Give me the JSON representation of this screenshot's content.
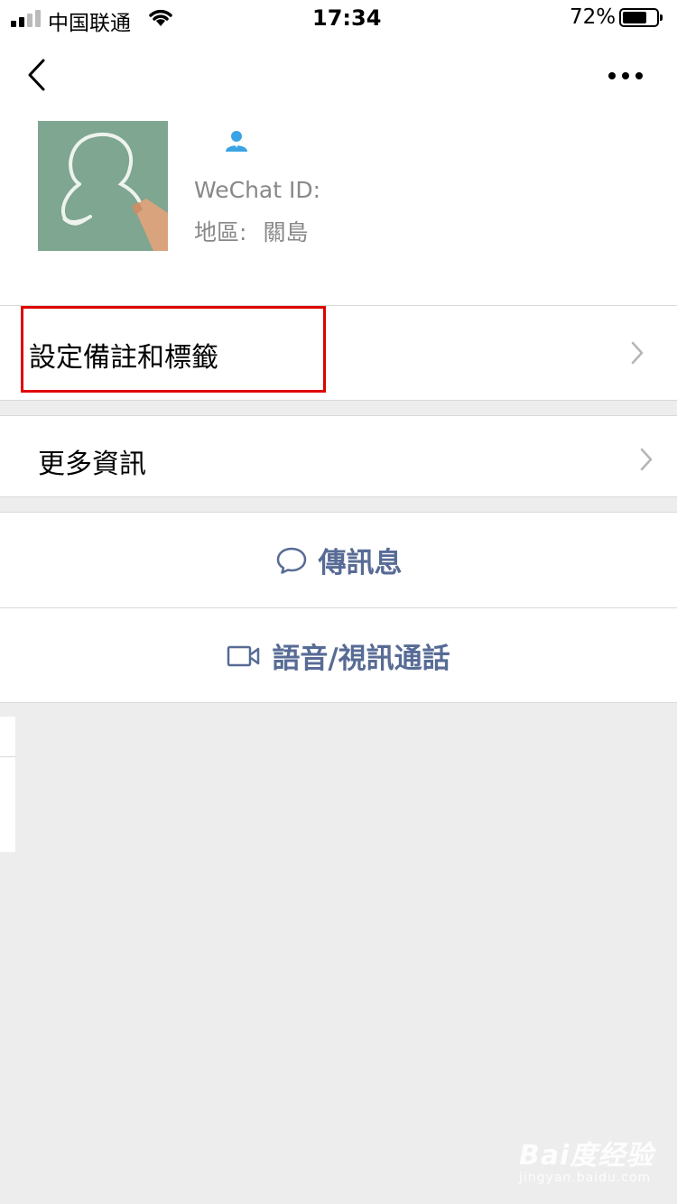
{
  "status_bar": {
    "carrier": "中国联通",
    "time": "17:34",
    "battery_percent": "72%",
    "battery_level": 0.72
  },
  "nav": {
    "back_icon": "chevron-left-icon",
    "more_icon": "more-dots-icon"
  },
  "profile": {
    "wechat_id_label": "WeChat ID:",
    "region_label": "地區:",
    "region_value": "關島",
    "gender_icon": "person-icon",
    "gender_icon_color": "#3aa3e3"
  },
  "rows": {
    "remarks_label": "設定備註和標籤",
    "more_info_label": "更多資訊"
  },
  "actions": {
    "message_label": "傳訊息",
    "call_label": "語音/視訊通話",
    "link_color": "#576b95"
  },
  "highlight_color": "#e00000",
  "watermark": {
    "logo": "Bai度经验",
    "sub": "jingyan.baidu.com"
  }
}
